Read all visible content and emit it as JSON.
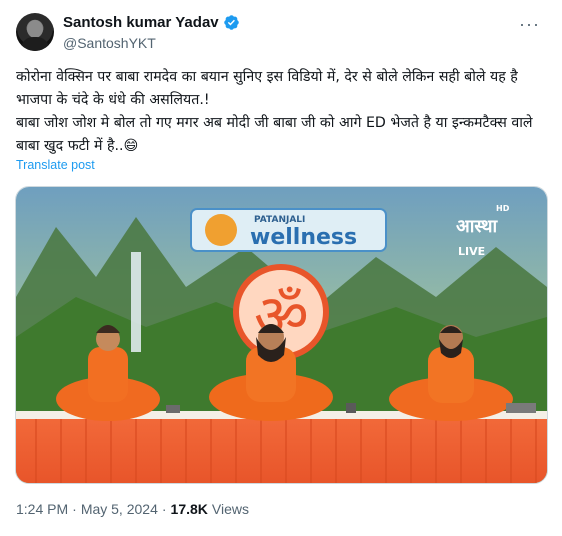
{
  "author": {
    "name": "Santosh kumar Yadav",
    "handle": "@SantoshYKT",
    "verified": true
  },
  "post": {
    "text": "कोरोना वेक्सिन पर बाबा रामदेव का बयान सुनिए इस विडियो में, देर से बोले लेकिन सही बोले यह है भाजपा के चंदे के धंधे की असलियत.!\nबाबा जोश जोश मे बोल तो गए मगर अब मोदी जी बाबा जी को आगे ED भेजते है या इन्कमटैक्स वाले बाबा खुद फटी में है..😄",
    "translate_label": "Translate post"
  },
  "media": {
    "banner_brand": "PATANJALI",
    "banner_text": "wellness",
    "channel_logo": "आस्था",
    "channel_hd": "HD",
    "channel_live": "LIVE",
    "symbol": "ॐ"
  },
  "meta": {
    "time": "1:24 PM",
    "separator": "·",
    "date": "May 5, 2024",
    "views_count": "17.8K",
    "views_label": "Views"
  },
  "colors": {
    "accent": "#1d9bf0",
    "muted": "#536471"
  },
  "icons": {
    "verified": "verified-badge-icon",
    "more": "more-options-icon"
  }
}
